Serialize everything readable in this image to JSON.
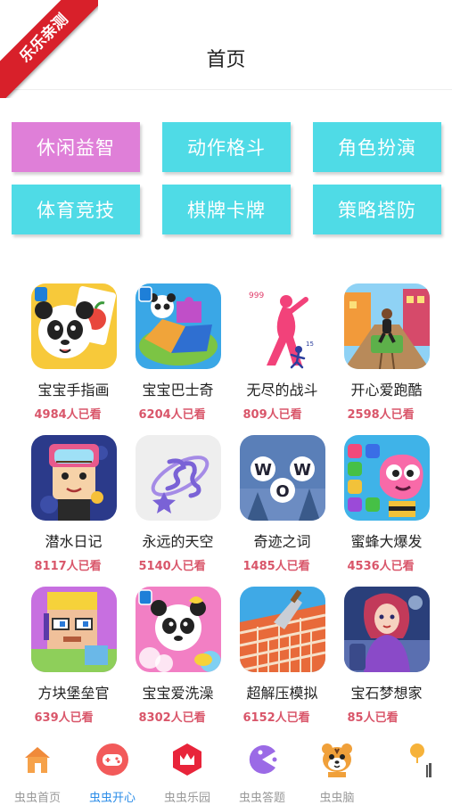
{
  "ribbon": "乐乐亲测",
  "header": {
    "title": "首页"
  },
  "categories": [
    {
      "label": "休闲益智",
      "active": true
    },
    {
      "label": "动作格斗",
      "active": false
    },
    {
      "label": "角色扮演",
      "active": false
    },
    {
      "label": "体育竞技",
      "active": false
    },
    {
      "label": "棋牌卡牌",
      "active": false
    },
    {
      "label": "策略塔防",
      "active": false
    }
  ],
  "games": [
    {
      "name": "宝宝手指画",
      "views": "4984人已看",
      "icon": "panda-finger-paint-icon"
    },
    {
      "name": "宝宝巴士奇",
      "views": "6204人已看",
      "icon": "panda-puzzle-icon"
    },
    {
      "name": "无尽的战斗",
      "views": "809人已看",
      "icon": "stick-fighter-icon"
    },
    {
      "name": "开心爱跑酷",
      "views": "2598人已看",
      "icon": "runner-icon"
    },
    {
      "name": "潜水日记",
      "views": "8117人已看",
      "icon": "diver-icon"
    },
    {
      "name": "永远的天空",
      "views": "5140人已看",
      "icon": "sky-logo-icon"
    },
    {
      "name": "奇迹之词",
      "views": "1485人已看",
      "icon": "word-puzzle-icon"
    },
    {
      "name": "蜜蜂大爆发",
      "views": "4536人已看",
      "icon": "bee-gems-icon"
    },
    {
      "name": "方块堡垒官",
      "views": "639人已看",
      "icon": "block-builder-icon"
    },
    {
      "name": "宝宝爱洗澡",
      "views": "8302人已看",
      "icon": "panda-bath-icon"
    },
    {
      "name": "超解压模拟",
      "views": "6152人已看",
      "icon": "brick-trowel-icon"
    },
    {
      "name": "宝石梦想家",
      "views": "85人已看",
      "icon": "dreamer-girl-icon"
    }
  ],
  "word_tiles": [
    "W",
    "O",
    "W"
  ],
  "tabs": [
    {
      "label": "虫虫首页",
      "icon": "home-icon",
      "active": false
    },
    {
      "label": "虫虫开心",
      "icon": "gamepad-icon",
      "active": true
    },
    {
      "label": "虫虫乐园",
      "icon": "crown-badge-icon",
      "active": false
    },
    {
      "label": "虫虫答题",
      "icon": "pacman-icon",
      "active": false
    },
    {
      "label": "虫虫脑",
      "icon": "tiger-mascot-icon",
      "active": false
    },
    {
      "label": "",
      "icon": "pin-icon",
      "active": false
    }
  ],
  "colors": {
    "active_category": "#df7fd8",
    "category": "#4fdbe6",
    "views_text": "#d9566a",
    "active_tab": "#2a8ce8",
    "ribbon": "#d8202a"
  }
}
